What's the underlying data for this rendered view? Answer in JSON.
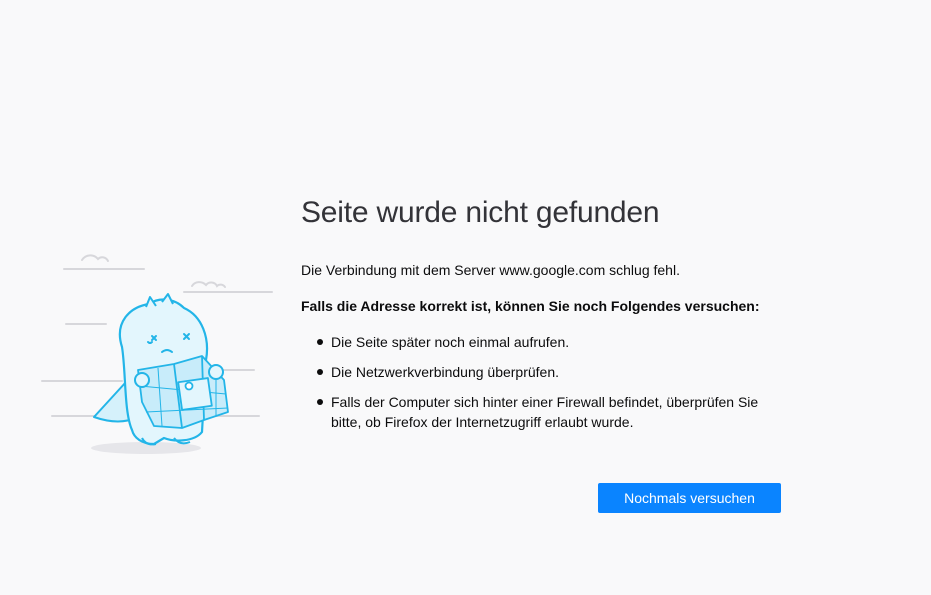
{
  "error": {
    "title": "Seite wurde nicht gefunden",
    "description": "Die Verbindung mit dem Server www.google.com schlug fehl.",
    "subtitle": "Falls die Adresse korrekt ist, können Sie noch Folgendes versuchen:",
    "tips": [
      "Die Seite später noch einmal aufrufen.",
      "Die Netzwerkverbindung überprüfen.",
      "Falls der Computer sich hinter einer Firewall befindet, überprüfen Sie bitte, ob Firefox der Internetzugriff erlaubt wurde."
    ],
    "retry_label": "Nochmals versuchen"
  },
  "colors": {
    "background": "#f9f9fa",
    "accent": "#0a84ff",
    "illustration_stroke": "#23b5e8",
    "illustration_fill": "#e3f6fd"
  },
  "illustration": {
    "icon": "lost-monster-map-illustration"
  }
}
